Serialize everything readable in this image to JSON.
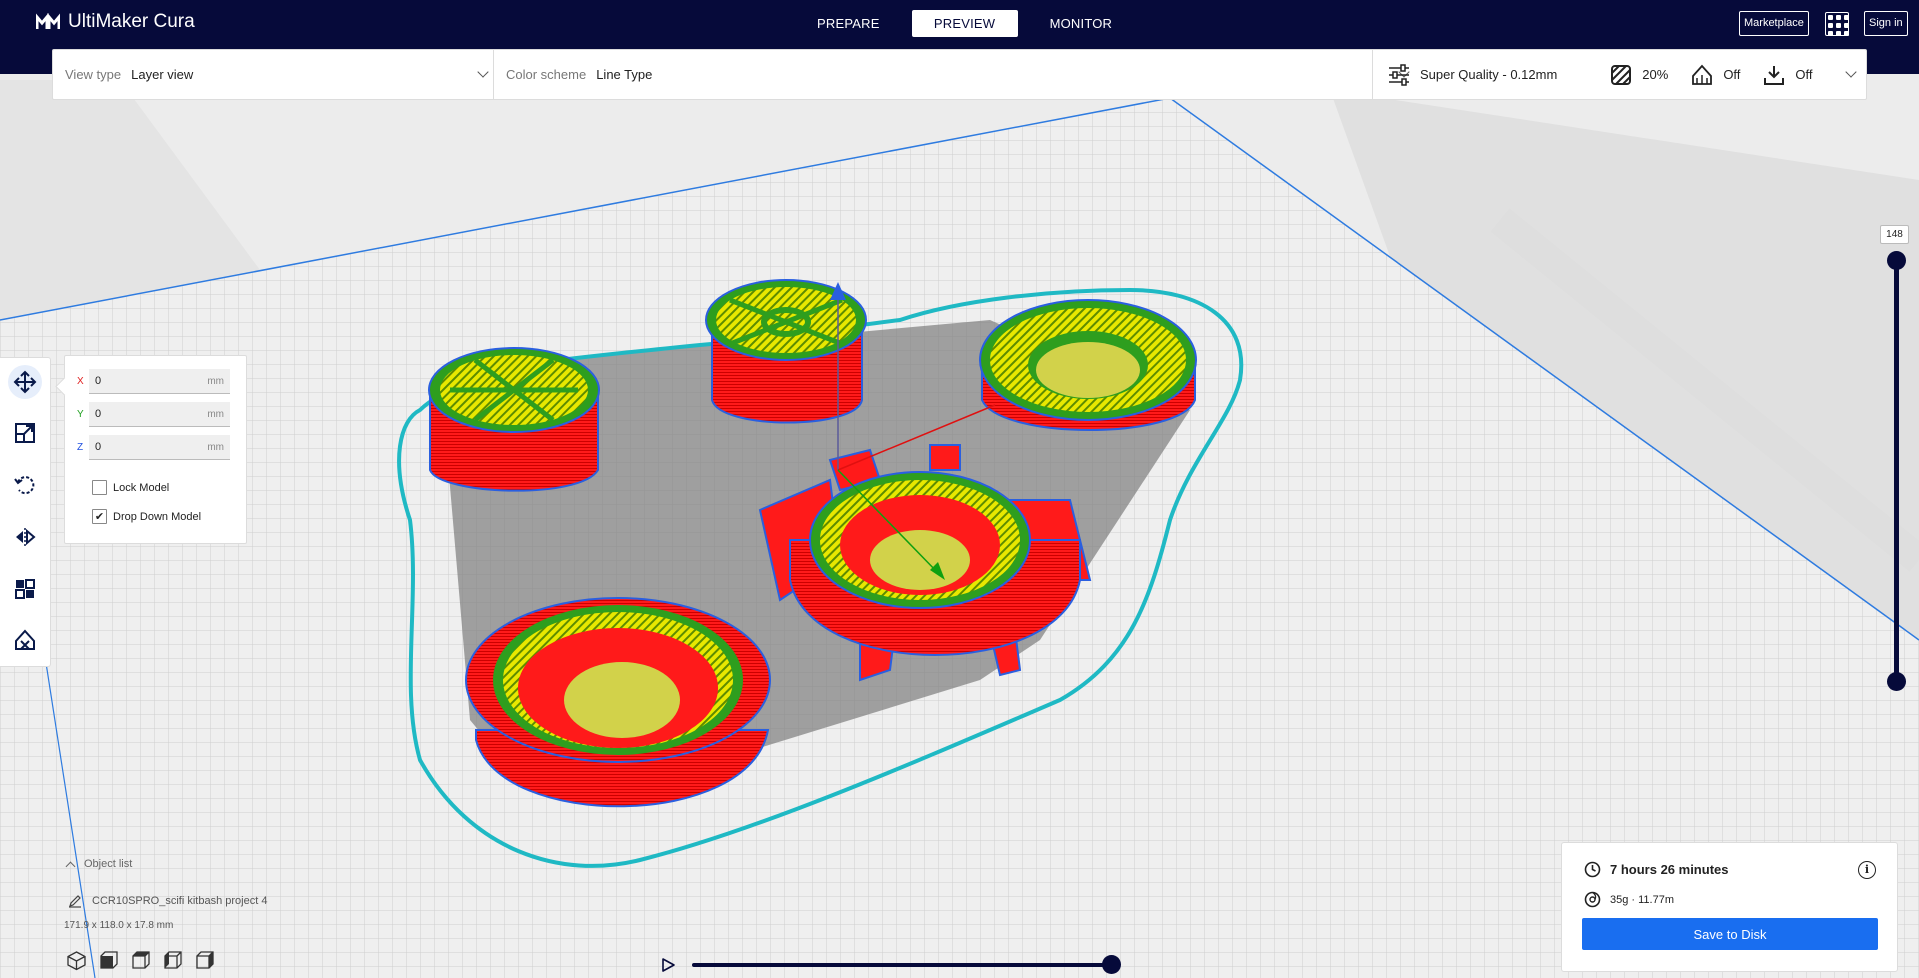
{
  "app": {
    "title": "UltiMaker Cura"
  },
  "header": {
    "stages": [
      {
        "label": "PREPARE",
        "active": false
      },
      {
        "label": "PREVIEW",
        "active": true
      },
      {
        "label": "MONITOR",
        "active": false
      }
    ],
    "marketplace_label": "Marketplace",
    "apps_icon": "grid-icon",
    "signin_label": "Sign in"
  },
  "toolbar": {
    "view_type_label": "View type",
    "view_type_value": "Layer view",
    "color_scheme_label": "Color scheme",
    "color_scheme_value": "Line Type",
    "profile": "Super Quality - 0.12mm",
    "infill": "20%",
    "support": "Off",
    "adhesion": "Off"
  },
  "tools": [
    "move-icon",
    "scale-icon",
    "rotate-icon",
    "mirror-icon",
    "per-model-settings-icon",
    "support-blocker-icon"
  ],
  "move_panel": {
    "x_label": "X",
    "x_value": "0",
    "y_label": "Y",
    "y_value": "0",
    "z_label": "Z",
    "z_value": "0",
    "unit": "mm",
    "lock_model_label": "Lock Model",
    "lock_model_checked": false,
    "drop_down_label": "Drop Down Model",
    "drop_down_checked": true
  },
  "layer_slider": {
    "current_layer": "148"
  },
  "object_list": {
    "toggle_label": "Object list",
    "file_name": "CCR10SPRO_scifi kitbash project 4",
    "dimensions": "171.9 x 118.0 x 17.8 mm"
  },
  "simulation": {
    "progress": 1.0
  },
  "print_info": {
    "time": "7 hours 26 minutes",
    "material": "35g · 11.77m",
    "save_label": "Save to Disk"
  },
  "colors": {
    "header": "#060a3a",
    "accent": "#196ef0",
    "wall_outer": "#ff0000",
    "wall_inner": "#00cc00",
    "infill": "#e6e600",
    "skirt": "#00cccc",
    "build_plate_edge": "#2e7be0"
  }
}
